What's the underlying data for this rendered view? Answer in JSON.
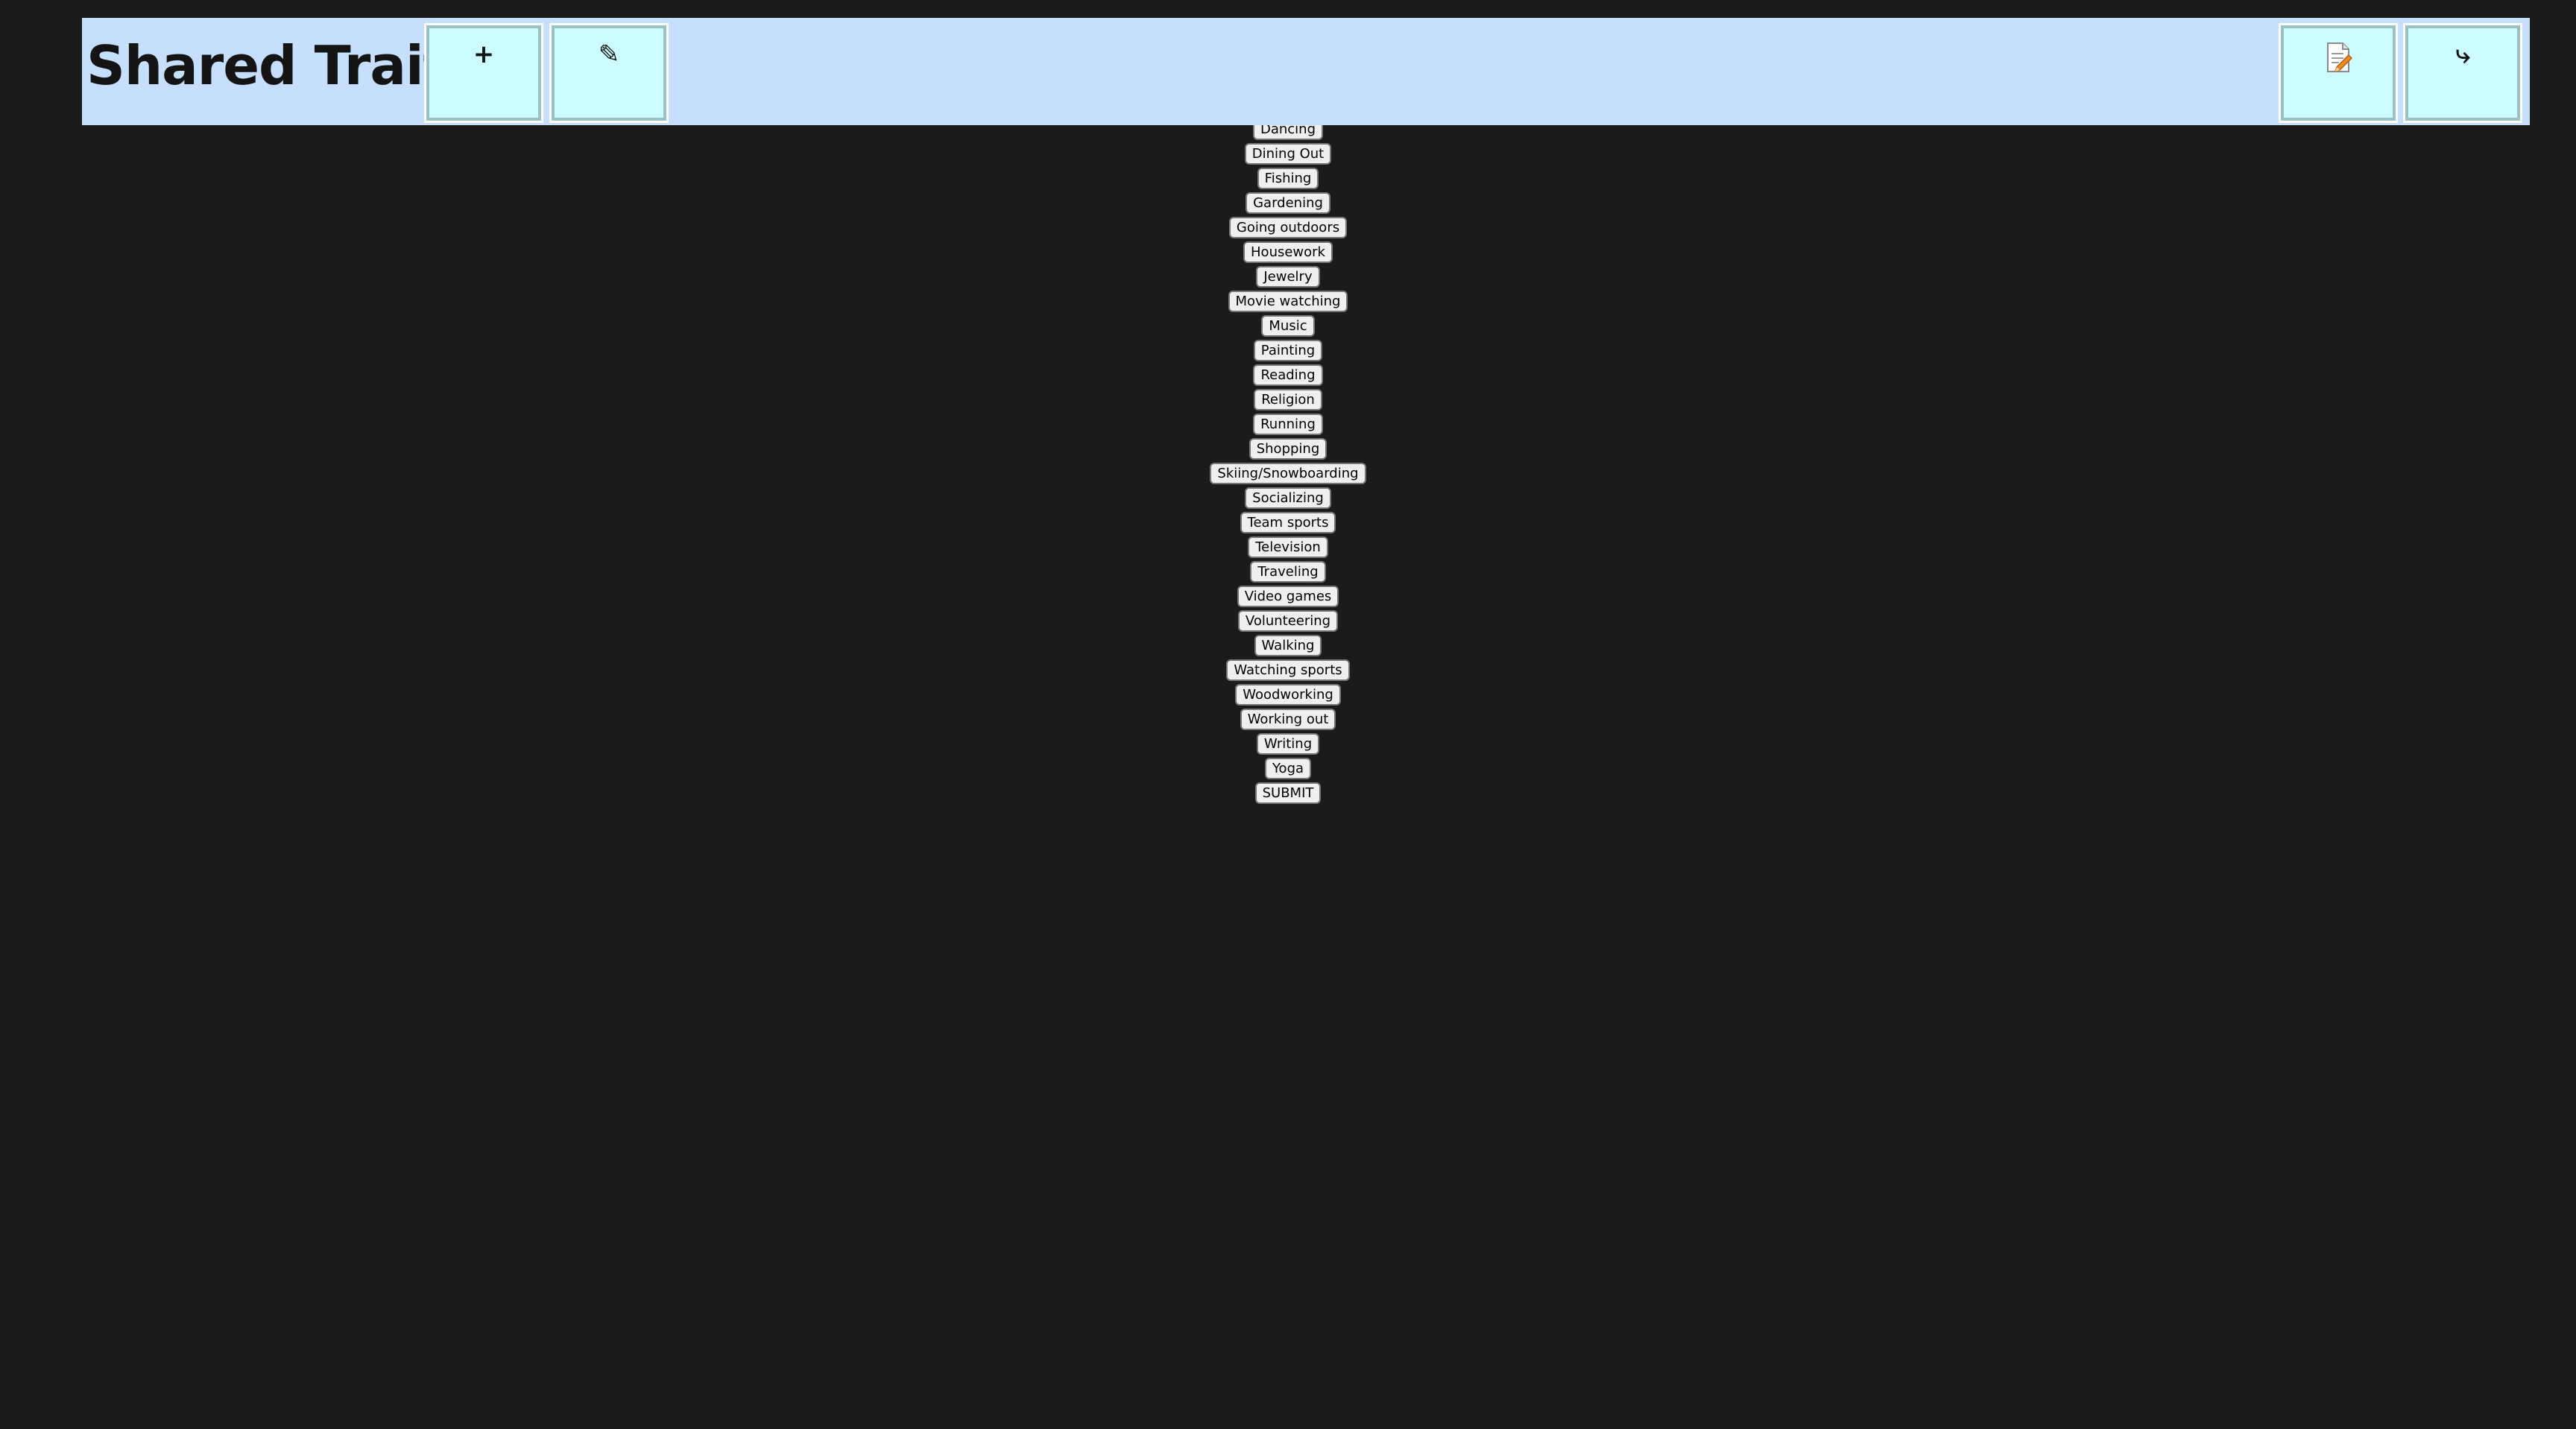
{
  "header": {
    "title": "Shared Traits",
    "add_icon": "plus-icon",
    "edit_icon": "pencil-icon",
    "notes_icon": "memo-icon",
    "back_icon": "return-arrow-icon",
    "add_glyph": "+",
    "edit_glyph": "✎",
    "back_glyph": "⤷",
    "background_color": "#c6dffd",
    "button_color": "#ccfcff"
  },
  "page": {
    "background_color": "#1b1b1b"
  },
  "traits": [
    "",
    "Dancing",
    "Dining Out",
    "Fishing",
    "Gardening",
    "Going outdoors",
    "Housework",
    "Jewelry",
    "Movie watching",
    "Music",
    "Painting",
    "Reading",
    "Religion",
    "Running",
    "Shopping",
    "Skiing/Snowboarding",
    "Socializing",
    "Team sports",
    "Television",
    "Traveling",
    "Video games",
    "Volunteering",
    "Walking",
    "Watching sports",
    "Woodworking",
    "Working out",
    "Writing",
    "Yoga"
  ],
  "submit_label": "SUBMIT"
}
